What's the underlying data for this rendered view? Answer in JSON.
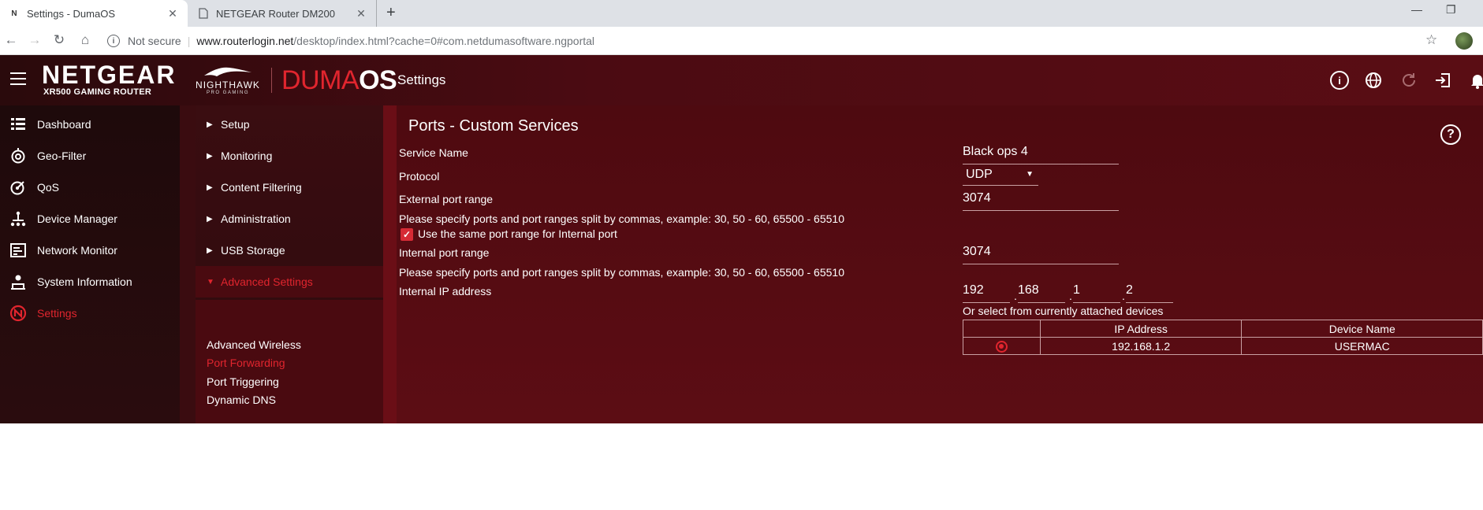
{
  "browser": {
    "tabs": [
      {
        "favicon": "N",
        "title": "Settings - DumaOS",
        "active": true
      },
      {
        "favicon": "doc-icon",
        "title": "NETGEAR Router DM200",
        "active": false
      }
    ],
    "address": {
      "security_label": "Not secure",
      "host": "www.routerlogin.net",
      "path": "/desktop/index.html?cache=0#com.netdumasoftware.ngportal"
    }
  },
  "header": {
    "brand": "NETGEAR",
    "model": "XR500 GAMING ROUTER",
    "nighthawk": "NIGHTHAWK",
    "nighthawk_sub": "PRO GAMING",
    "os_prefix": "DUMA",
    "os_suffix": "OS",
    "page": "Settings",
    "icons": [
      "info-icon",
      "globe-icon",
      "refresh-icon",
      "logout-icon",
      "bell-icon"
    ]
  },
  "sidebar": {
    "items": [
      {
        "label": "Dashboard",
        "icon": "dashboard-icon"
      },
      {
        "label": "Geo-Filter",
        "icon": "geofilter-icon"
      },
      {
        "label": "QoS",
        "icon": "qos-icon"
      },
      {
        "label": "Device Manager",
        "icon": "device-manager-icon"
      },
      {
        "label": "Network Monitor",
        "icon": "network-monitor-icon"
      },
      {
        "label": "System Information",
        "icon": "system-info-icon"
      },
      {
        "label": "Settings",
        "icon": "settings-icon",
        "active": true
      }
    ]
  },
  "submenu": {
    "items": [
      {
        "label": "Setup"
      },
      {
        "label": "Monitoring"
      },
      {
        "label": "Content Filtering"
      },
      {
        "label": "Administration"
      },
      {
        "label": "USB Storage"
      },
      {
        "label": "Advanced Settings",
        "open": true
      }
    ],
    "children": [
      {
        "label": "Advanced Wireless"
      },
      {
        "label": "Port Forwarding",
        "active": true
      },
      {
        "label": "Port Triggering"
      },
      {
        "label": "Dynamic DNS"
      }
    ]
  },
  "form": {
    "title": "Ports - Custom Services",
    "service_name_label": "Service Name",
    "service_name_value": "Black ops 4",
    "protocol_label": "Protocol",
    "protocol_value": "UDP",
    "external_label": "External port range",
    "external_value": "3074",
    "hint1": "Please specify ports and port ranges split by commas, example: 30, 50 - 60, 65500 - 65510",
    "same_range_label": "Use the same port range for Internal port",
    "same_range_checked": true,
    "internal_label": "Internal port range",
    "internal_value": "3074",
    "hint2": "Please specify ports and port ranges split by commas, example: 30, 50 - 60, 65500 - 65510",
    "ip_label": "Internal IP address",
    "ip": [
      "192",
      "168",
      "1",
      "2"
    ],
    "select_hint": "Or select from currently attached devices",
    "table": {
      "headers": [
        "",
        "IP Address",
        "Device Name"
      ],
      "rows": [
        {
          "selected": true,
          "ip": "192.168.1.2",
          "name": "USERMAC"
        }
      ]
    }
  },
  "colors": {
    "accent": "#e1252e",
    "background": "#5a0a10"
  }
}
